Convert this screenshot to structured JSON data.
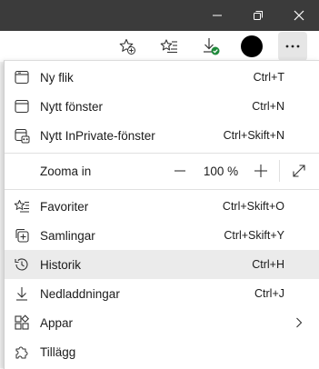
{
  "window": {
    "minimize_icon": "minimize-icon",
    "restore_icon": "restore-icon",
    "close_icon": "close-icon"
  },
  "toolbar": {
    "icons": [
      "add-favorite-icon",
      "favorites-icon",
      "downloads-icon",
      "profile-avatar",
      "more-icon"
    ]
  },
  "menu": {
    "items": [
      {
        "label": "Ny flik",
        "shortcut": "Ctrl+T",
        "icon": "new-tab-icon"
      },
      {
        "label": "Nytt fönster",
        "shortcut": "Ctrl+N",
        "icon": "new-window-icon"
      },
      {
        "label": "Nytt InPrivate-fönster",
        "shortcut": "Ctrl+Skift+N",
        "icon": "inprivate-icon"
      }
    ],
    "zoom": {
      "label": "Zooma in",
      "value": "100 %",
      "minus_icon": "minus-icon",
      "plus_icon": "plus-icon",
      "fullscreen_icon": "fullscreen-icon"
    },
    "items2": [
      {
        "label": "Favoriter",
        "shortcut": "Ctrl+Skift+O",
        "icon": "favorites-icon"
      },
      {
        "label": "Samlingar",
        "shortcut": "Ctrl+Skift+Y",
        "icon": "collections-icon"
      },
      {
        "label": "Historik",
        "shortcut": "Ctrl+H",
        "icon": "history-icon"
      },
      {
        "label": "Nedladdningar",
        "shortcut": "Ctrl+J",
        "icon": "downloads-icon"
      },
      {
        "label": "Appar",
        "shortcut": "",
        "icon": "apps-icon",
        "submenu_icon": "chevron-right-icon"
      },
      {
        "label": "Tillägg",
        "shortcut": "",
        "icon": "extensions-icon"
      }
    ]
  },
  "colors": {
    "titlebar": "#3b3b3b",
    "highlight": "#ebebeb",
    "download_badge": "#1f8a3b"
  }
}
